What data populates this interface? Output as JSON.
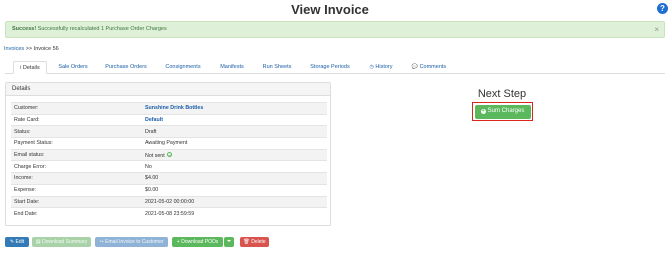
{
  "page": {
    "title": "View Invoice",
    "help_icon": "?"
  },
  "alert": {
    "strong": "Success!",
    "message": " Successfully recalculated 1 Purchase Order Charges",
    "close": "×"
  },
  "breadcrumb": {
    "link": "Invoices",
    "separator": " >> ",
    "current": "Invoice 56"
  },
  "tabs": [
    {
      "icon": "i",
      "label": "Details"
    },
    {
      "label": "Sale Orders"
    },
    {
      "label": "Purchase Orders"
    },
    {
      "label": "Consignments"
    },
    {
      "label": "Manifests"
    },
    {
      "label": "Run Sheets"
    },
    {
      "label": "Storage Periods"
    },
    {
      "icon": "◷",
      "label": "History"
    },
    {
      "icon": "💬",
      "label": "Comments"
    }
  ],
  "details": {
    "heading": "Details",
    "rows": [
      {
        "label": "Customer:",
        "value": "Sunshine Drink Bottles"
      },
      {
        "label": "Rate Card:",
        "value": "Default"
      },
      {
        "label": "Status:",
        "value": "Draft"
      },
      {
        "label": "Payment Status:",
        "value": "Awaiting Payment"
      },
      {
        "label": "Email status:",
        "value": "Not sent"
      },
      {
        "label": "Charge Error:",
        "value": "No"
      },
      {
        "label": "Income:",
        "value": "$4.00"
      },
      {
        "label": "Expense:",
        "value": "$0.00"
      },
      {
        "label": "Start Date:",
        "value": "2021-05-02 00:00:00"
      },
      {
        "label": "End Date:",
        "value": "2021-05-08 23:59:59"
      }
    ]
  },
  "next_step": {
    "heading": "Next Step",
    "button": "Sum Charges"
  },
  "actions": {
    "edit": "Edit",
    "download_summary": "Download Summary",
    "email_invoice": "Email Invoice to Customer",
    "download_pods": "Download PODs",
    "delete": "Delete"
  },
  "colors": {
    "primary": "#337ab7",
    "success": "#5cb85c",
    "danger": "#d9534f",
    "highlight": "#d9281b"
  }
}
